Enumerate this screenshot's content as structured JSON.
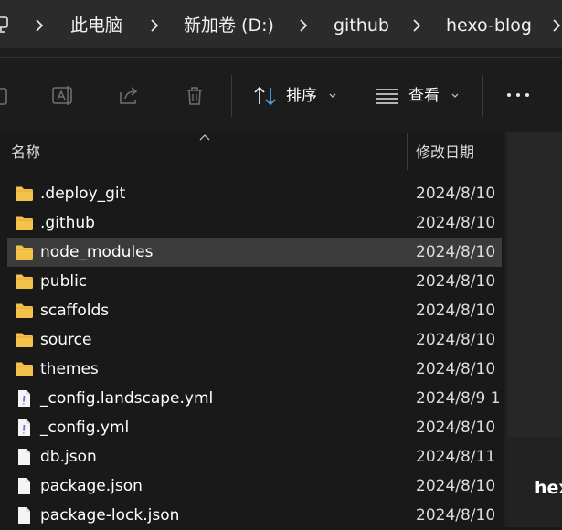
{
  "address_bar": {
    "crumbs": [
      "此电脑",
      "新加卷 (D:)",
      "github",
      "hexo-blog"
    ]
  },
  "toolbar": {
    "sort_label": "排序",
    "view_label": "查看"
  },
  "file_list": {
    "columns": {
      "name": "名称",
      "date_modified": "修改日期"
    },
    "rows": [
      {
        "name": ".deploy_git",
        "date": "2024/8/10",
        "type": "folder",
        "selected": false
      },
      {
        "name": ".github",
        "date": "2024/8/10",
        "type": "folder",
        "selected": false
      },
      {
        "name": "node_modules",
        "date": "2024/8/10",
        "type": "folder",
        "selected": true
      },
      {
        "name": "public",
        "date": "2024/8/10",
        "type": "folder",
        "selected": false
      },
      {
        "name": "scaffolds",
        "date": "2024/8/10",
        "type": "folder",
        "selected": false
      },
      {
        "name": "source",
        "date": "2024/8/10",
        "type": "folder",
        "selected": false
      },
      {
        "name": "themes",
        "date": "2024/8/10",
        "type": "folder",
        "selected": false
      },
      {
        "name": "_config.landscape.yml",
        "date": "2024/8/9 1",
        "type": "yml",
        "selected": false
      },
      {
        "name": "_config.yml",
        "date": "2024/8/10",
        "type": "yml",
        "selected": false
      },
      {
        "name": "db.json",
        "date": "2024/8/11",
        "type": "file",
        "selected": false
      },
      {
        "name": "package.json",
        "date": "2024/8/10",
        "type": "file",
        "selected": false
      },
      {
        "name": "package-lock.json",
        "date": "2024/8/10",
        "type": "file",
        "selected": false
      }
    ]
  },
  "preview_pane": {
    "title_fragment": "hex"
  },
  "colors": {
    "folder": "#f3c24b",
    "selection": "#3b3b3b",
    "accent_blue": "#4aa3df",
    "yml_accent": "#9b59d0"
  },
  "icons": {
    "pc": "computer-icon",
    "chevron": "chevron-right-icon",
    "folder": "folder-icon",
    "yml": "yml-file-icon",
    "file": "file-icon"
  }
}
